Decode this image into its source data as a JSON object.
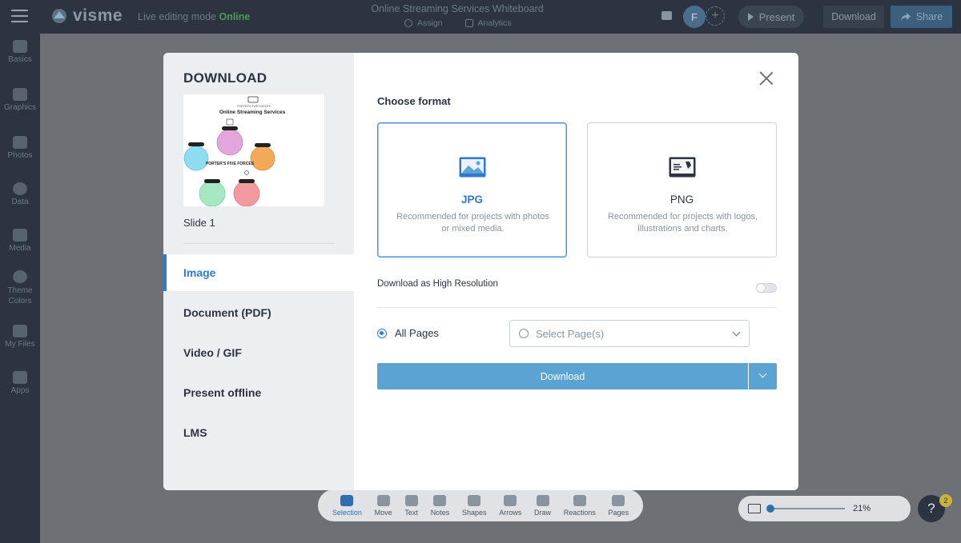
{
  "app": {
    "logo_text": "visme",
    "edit_mode_label": "Live editing mode",
    "edit_mode_status": "Online",
    "doc_title": "Online Streaming Services Whiteboard",
    "assign_label": "Assign",
    "analytics_label": "Analytics",
    "avatar_initial": "F",
    "present_label": "Present",
    "download_label": "Download",
    "share_label": "Share"
  },
  "sidebar": {
    "items": [
      {
        "label": "Basics",
        "icon": "basics-icon"
      },
      {
        "label": "Graphics",
        "icon": "graphics-icon"
      },
      {
        "label": "Photos",
        "icon": "photos-icon"
      },
      {
        "label": "Data",
        "icon": "data-icon"
      },
      {
        "label": "Media",
        "icon": "media-icon"
      },
      {
        "label": "Theme Colors",
        "icon": "theme-colors-icon"
      },
      {
        "label": "My Files",
        "icon": "my-files-icon"
      },
      {
        "label": "Apps",
        "icon": "apps-icon"
      }
    ]
  },
  "toolbar": {
    "tools": [
      {
        "label": "Selection",
        "active": true
      },
      {
        "label": "Move"
      },
      {
        "label": "Text"
      },
      {
        "label": "Notes"
      },
      {
        "label": "Shapes"
      },
      {
        "label": "Arrows"
      },
      {
        "label": "Draw"
      },
      {
        "label": "Reactions"
      },
      {
        "label": "Pages"
      }
    ],
    "zoom": "21%",
    "help": "?",
    "help_badge": "2"
  },
  "modal": {
    "title": "DOWNLOAD",
    "thumbnail": {
      "top_label": "PORTER'S FIVE FORCES",
      "title": "Online Streaming Services",
      "center_text": "PORTER'S FIVE FORCES",
      "colors": [
        "#d99ad6",
        "#6fd3ee",
        "#f0a149",
        "#8fe3b3",
        "#f08a8f"
      ]
    },
    "slide_label": "Slide 1",
    "nav": [
      {
        "label": "Image",
        "active": true
      },
      {
        "label": "Document (PDF)"
      },
      {
        "label": "Video / GIF"
      },
      {
        "label": "Present offline"
      },
      {
        "label": "LMS"
      }
    ],
    "choose_format_label": "Choose format",
    "formats": [
      {
        "name": "JPG",
        "desc_line1": "Recommended for projects with photos",
        "desc_line2": "or mixed media.",
        "selected": true
      },
      {
        "name": "PNG",
        "desc_line1": "Recommended for projects with logos,",
        "desc_line2": "illustrations and charts.",
        "selected": false
      }
    ],
    "hires_label": "Download as High Resolution",
    "hires_enabled": false,
    "all_pages_label": "All Pages",
    "select_pages_placeholder": "Select Page(s)",
    "download_button": "Download"
  },
  "colors": {
    "accent": "#2f7ad0",
    "download_button": "#5aa4d3",
    "topbar": "#2b3440"
  }
}
